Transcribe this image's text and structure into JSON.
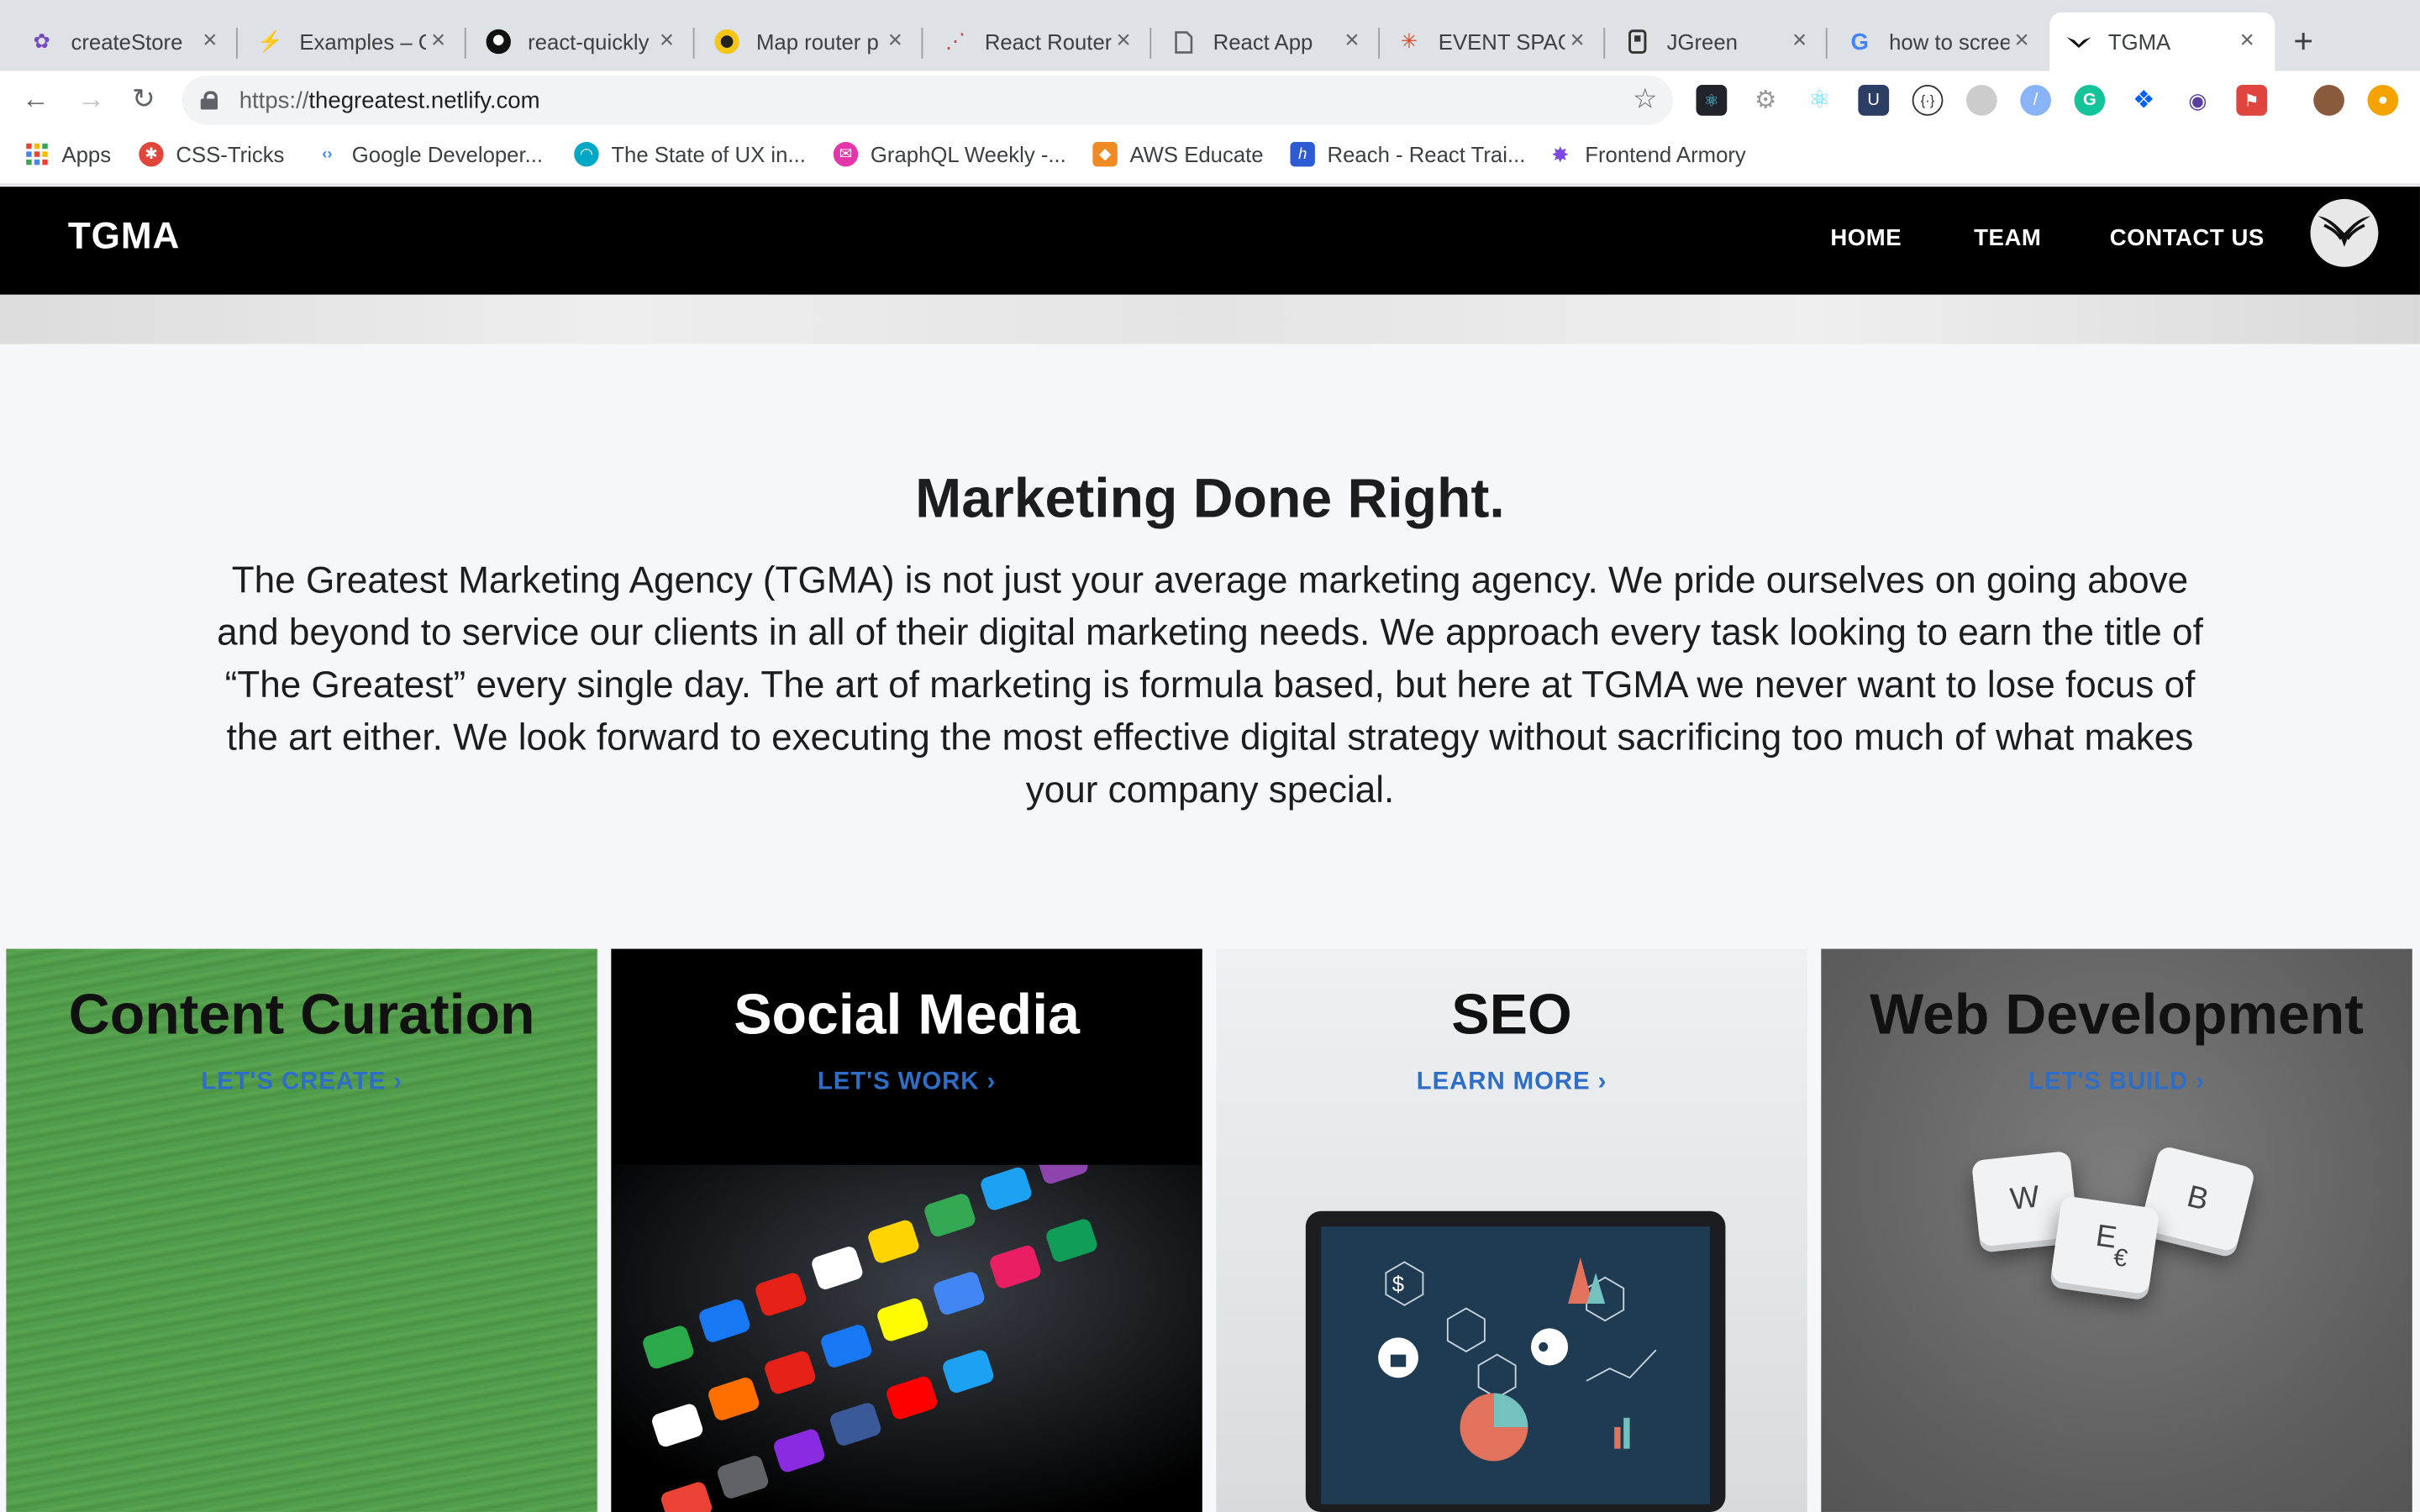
{
  "browser": {
    "tabs": [
      {
        "title": "createStore",
        "icon": "redux-icon"
      },
      {
        "title": "Examples – C",
        "icon": "bolt-icon"
      },
      {
        "title": "react-quickly",
        "icon": "github-icon"
      },
      {
        "title": "Map router p",
        "icon": "map-icon"
      },
      {
        "title": "React Router",
        "icon": "react-router-icon"
      },
      {
        "title": "React App",
        "icon": "document-icon"
      },
      {
        "title": "EVENT SPACE",
        "icon": "event-icon"
      },
      {
        "title": "JGreen",
        "icon": "jgreen-icon"
      },
      {
        "title": "how to scree",
        "icon": "google-icon"
      },
      {
        "title": "TGMA",
        "icon": "tgma-icon"
      }
    ],
    "active_tab_index": 9,
    "url_scheme": "https://",
    "url_host": "thegreatest.netlify.com",
    "bookmarks": [
      {
        "label": "Apps",
        "icon": "apps-grid-icon",
        "color": "#ea4335"
      },
      {
        "label": "CSS-Tricks",
        "icon": "css-tricks-icon",
        "color": "#e2463a"
      },
      {
        "label": "Google Developer...",
        "icon": "google-developers-icon",
        "color": "#4285f4"
      },
      {
        "label": "The State of UX in...",
        "icon": "ux-icon",
        "color": "#00a8c6"
      },
      {
        "label": "GraphQL Weekly -...",
        "icon": "graphql-icon",
        "color": "#e535ab"
      },
      {
        "label": "AWS Educate",
        "icon": "aws-icon",
        "color": "#f08a24"
      },
      {
        "label": "Reach - React Trai...",
        "icon": "reach-icon",
        "color": "#2d5bd3"
      },
      {
        "label": "Frontend Armory",
        "icon": "frontend-armory-icon",
        "color": "#7b4ae2"
      }
    ]
  },
  "site": {
    "brand": "TGMA",
    "nav": [
      "HOME",
      "TEAM",
      "CONTACT US"
    ],
    "headline": "Marketing Done Right.",
    "intro": "The Greatest Marketing Agency (TGMA) is not just your average marketing agency. We pride ourselves on going above and beyond to service our clients in all of their digital marketing needs. We approach every task looking to earn the title of “The Greatest” every single day. The art of marketing is formula based, but here at TGMA we never want to lose focus of the art either. We look forward to executing the most effective digital strategy without sacrificing too much of what makes your company special.",
    "cards": [
      {
        "title": "Content Curation",
        "cta": "LET'S CREATE",
        "title_color": "#111111"
      },
      {
        "title": "Social Media",
        "cta": "LET'S WORK",
        "title_color": "#ffffff"
      },
      {
        "title": "SEO",
        "cta": "LEARN MORE",
        "title_color": "#111111"
      },
      {
        "title": "Web Development",
        "cta": "LET'S BUILD",
        "title_color": "#111111"
      }
    ],
    "keycaps": [
      "W",
      "E",
      "B",
      "€"
    ]
  }
}
